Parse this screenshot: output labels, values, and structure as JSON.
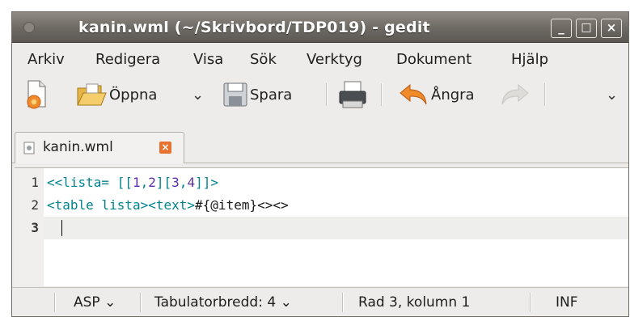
{
  "window": {
    "title": "kanin.wml (~/Skrivbord/TDP019) - gedit",
    "controls": {
      "minimize": "_",
      "maximize": "□",
      "close": "×"
    }
  },
  "menubar": {
    "items": [
      "Arkiv",
      "Redigera",
      "Visa",
      "Sök",
      "Verktyg",
      "Dokument",
      "Hjälp"
    ]
  },
  "toolbar": {
    "open_label": "Öppna",
    "save_label": "Spara",
    "undo_label": "Ångra"
  },
  "tab": {
    "label": "kanin.wml",
    "close": "×"
  },
  "editor": {
    "lines": [
      {
        "number": "1"
      },
      {
        "number": "2"
      },
      {
        "number": "3"
      }
    ],
    "line1": {
      "a": "<<lista=",
      "b": " [[",
      "c": "1",
      "d": ",",
      "e": "2",
      "f": "][",
      "g": "3",
      "h": ",",
      "i": "4",
      "j": "]]>"
    },
    "line2": {
      "a": "<table lista>",
      "b": "<text>",
      "c": "#{@item}<><>"
    }
  },
  "statusbar": {
    "language": "ASP",
    "tab_width": "Tabulatorbredd: 4",
    "position": "Rad 3, kolumn 1",
    "mode": "INF"
  },
  "colors": {
    "tag": "#00838f",
    "number": "#5c2fa6",
    "close_accent": "#e8722f"
  }
}
